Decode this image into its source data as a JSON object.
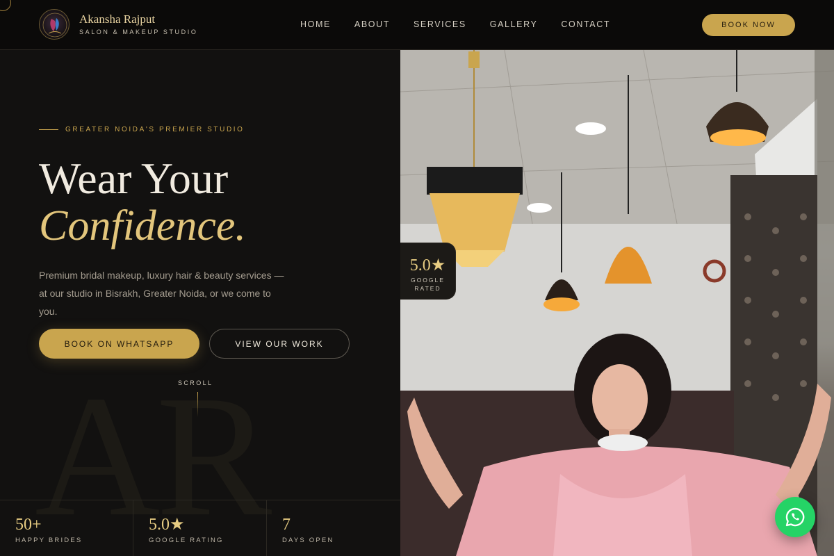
{
  "brand": {
    "name": "Akansha Rajput",
    "tagline": "SALON & MAKEUP STUDIO"
  },
  "nav": {
    "items": [
      "HOME",
      "ABOUT",
      "SERVICES",
      "GALLERY",
      "CONTACT"
    ],
    "cta": "BOOK NOW"
  },
  "hero": {
    "eyebrow": "GREATER NOIDA'S PREMIER STUDIO",
    "headline_line1": "Wear Your",
    "headline_line2": "Confidence.",
    "description": "Premium bridal makeup, luxury hair & beauty services — at our studio in Bisrakh, Greater Noida, or we come to you.",
    "primary_button": "BOOK ON WHATSAPP",
    "secondary_button": "VIEW OUR WORK",
    "scroll_label": "SCROLL",
    "watermark": "AR"
  },
  "stats": [
    {
      "value": "50+",
      "label": "HAPPY BRIDES"
    },
    {
      "value": "5.0★",
      "label": "GOOGLE RATING"
    },
    {
      "value": "7",
      "label": "DAYS OPEN"
    }
  ],
  "rating_card": {
    "value": "5.0★",
    "label_line1": "GOOGLE",
    "label_line2": "RATED"
  },
  "colors": {
    "gold": "#c9a54e",
    "gold_light": "#e3c67c",
    "background": "#121110",
    "whatsapp": "#25d366"
  },
  "icons": {
    "whatsapp_fab": "whatsapp-icon",
    "logo": "brand-logo"
  }
}
